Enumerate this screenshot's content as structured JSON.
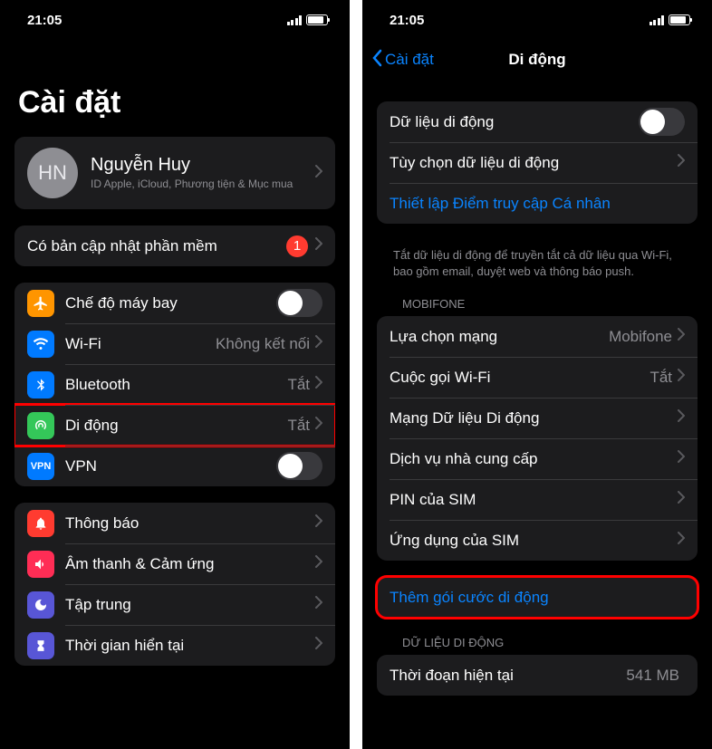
{
  "status": {
    "time": "21:05"
  },
  "colors": {
    "orange": "#ff9500",
    "blue": "#007aff",
    "green": "#34c759",
    "bluealt": "#5856d6",
    "red": "#ff3b30",
    "pink": "#ff2d55",
    "purple": "#5856d6",
    "darkblue": "#0a84ff"
  },
  "left": {
    "pageTitle": "Cài đặt",
    "profile": {
      "initials": "HN",
      "name": "Nguyễn Huy",
      "sub": "ID Apple, iCloud, Phương tiện & Mục mua"
    },
    "update": {
      "label": "Có bản cập nhật phần mềm",
      "badge": "1"
    },
    "items": [
      {
        "label": "Chế độ máy bay",
        "icon": "airplane",
        "bg": "#ff9500",
        "type": "switch",
        "on": false
      },
      {
        "label": "Wi-Fi",
        "icon": "wifi",
        "bg": "#007aff",
        "type": "value",
        "value": "Không kết nối"
      },
      {
        "label": "Bluetooth",
        "icon": "bluetooth",
        "bg": "#007aff",
        "type": "value",
        "value": "Tắt"
      },
      {
        "label": "Di động",
        "icon": "cellular",
        "bg": "#34c759",
        "type": "value",
        "value": "Tắt",
        "highlight": true
      },
      {
        "label": "VPN",
        "icon": "vpn",
        "bg": "#007aff",
        "type": "switch",
        "on": false
      }
    ],
    "items2": [
      {
        "label": "Thông báo",
        "icon": "bell",
        "bg": "#ff3b30"
      },
      {
        "label": "Âm thanh & Cảm ứng",
        "icon": "sound",
        "bg": "#ff2d55"
      },
      {
        "label": "Tập trung",
        "icon": "moon",
        "bg": "#5856d6"
      },
      {
        "label": "Thời gian hiển tại",
        "icon": "hourglass",
        "bg": "#5856d6"
      }
    ]
  },
  "right": {
    "backLabel": "Cài đặt",
    "navTitle": "Di động",
    "g1": [
      {
        "label": "Dữ liệu di động",
        "type": "switch",
        "on": false
      },
      {
        "label": "Tùy chọn dữ liệu di động",
        "type": "chev"
      },
      {
        "label": "Thiết lập Điểm truy cập Cá nhân",
        "type": "link"
      }
    ],
    "g1Footer": "Tắt dữ liệu di động để truyền tắt cả dữ liệu qua Wi-Fi, bao gồm email, duyệt web và thông báo push.",
    "carrierHeader": "MOBIFONE",
    "g2": [
      {
        "label": "Lựa chọn mạng",
        "value": "Mobifone"
      },
      {
        "label": "Cuộc gọi Wi-Fi",
        "value": "Tắt"
      },
      {
        "label": "Mạng Dữ liệu Di động"
      },
      {
        "label": "Dịch vụ nhà cung cấp"
      },
      {
        "label": "PIN của SIM"
      },
      {
        "label": "Ứng dụng của SIM"
      }
    ],
    "addPlan": "Thêm gói cước di động",
    "dataHeader": "DỮ LIỆU DI ĐỘNG",
    "usage": {
      "label": "Thời đoạn hiện tại",
      "value": "541 MB"
    }
  }
}
